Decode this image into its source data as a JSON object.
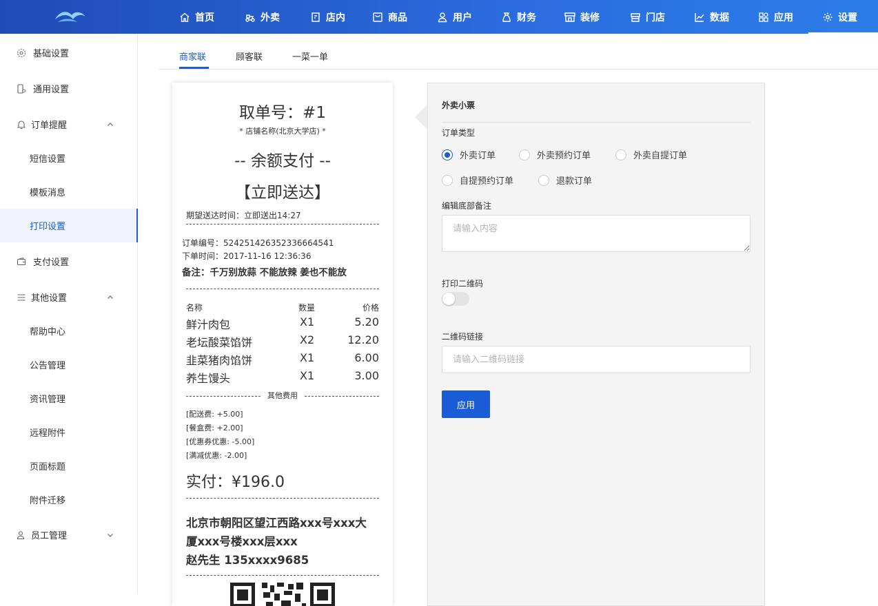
{
  "topnav": {
    "items": [
      {
        "label": "首页",
        "icon": "home-icon"
      },
      {
        "label": "外卖",
        "icon": "delivery-icon"
      },
      {
        "label": "店内",
        "icon": "dine-in-icon"
      },
      {
        "label": "商品",
        "icon": "goods-icon"
      },
      {
        "label": "用户",
        "icon": "user-icon"
      },
      {
        "label": "财务",
        "icon": "finance-icon"
      },
      {
        "label": "装修",
        "icon": "decoration-icon"
      },
      {
        "label": "门店",
        "icon": "store-icon"
      },
      {
        "label": "数据",
        "icon": "data-chart-icon"
      },
      {
        "label": "应用",
        "icon": "apps-icon"
      },
      {
        "label": "设置",
        "icon": "gear-icon"
      }
    ],
    "active": "设置"
  },
  "sidebar": {
    "items": [
      {
        "label": "基础设置",
        "icon": "gear-icon"
      },
      {
        "label": "通用设置",
        "icon": "phone-settings-icon"
      },
      {
        "label": "订单提醒",
        "icon": "bell-icon"
      },
      {
        "label": "短信设置"
      },
      {
        "label": "模板消息"
      },
      {
        "label": "打印设置"
      },
      {
        "label": "支付设置",
        "icon": "wallet-icon"
      },
      {
        "label": "其他设置",
        "icon": "menu-lines-icon"
      },
      {
        "label": "帮助中心"
      },
      {
        "label": "公告管理"
      },
      {
        "label": "资讯管理"
      },
      {
        "label": "远程附件"
      },
      {
        "label": "页面标题"
      },
      {
        "label": "附件迁移"
      },
      {
        "label": "员工管理",
        "icon": "staff-icon"
      }
    ],
    "active": "打印设置"
  },
  "tabs": [
    "商家联",
    "顾客联",
    "一菜一单"
  ],
  "receipt": {
    "pickup_no": "取单号：#1",
    "store_name": "* 店铺名称(北京大学店) *",
    "payment": "-- 余额支付 --",
    "delivery_mode": "【立即送达】",
    "expected_time": "期望送达时间：立即送出14:27",
    "order_no": "订单编号：524251426352336664541",
    "order_time": "下单时间：2017-11-16 12:36:36",
    "remark": "备注：千万别放蒜 不能放辣 姜也不能放",
    "columns": [
      "名称",
      "数量",
      "价格"
    ],
    "items": [
      {
        "name": "鲜汁肉包",
        "qty": "X1",
        "price": "5.20"
      },
      {
        "name": "老坛酸菜馅饼",
        "qty": "X2",
        "price": "12.20"
      },
      {
        "name": "韭菜猪肉馅饼",
        "qty": "X1",
        "price": "6.00"
      },
      {
        "name": "养生馒头",
        "qty": "X1",
        "price": "3.00"
      }
    ],
    "other_fees_title": "其他费用",
    "fees": [
      "[配送费: +5.00]",
      "[餐盒费: +2.00]",
      "[优惠券优惠: -5.00]",
      "[满减优惠: -2.00]"
    ],
    "total": "实付：¥196.0",
    "address_line1": "北京市朝阳区望江西路xxx号xxx大",
    "address_line2": "厦xxx号楼xxx层xxx",
    "contact": "赵先生 135xxxx9685"
  },
  "form": {
    "title": "外卖小票",
    "order_type_label": "订单类型",
    "order_types": [
      "外卖订单",
      "外卖预约订单",
      "外卖自提订单",
      "自提预约订单",
      "退款订单"
    ],
    "selected_order_type": "外卖订单",
    "footer_note_label": "编辑底部备注",
    "footer_note_placeholder": "请输入内容",
    "qr_label": "打印二维码",
    "qr_enabled": false,
    "qr_link_label": "二维码链接",
    "qr_link_placeholder": "请输入二维码链接",
    "apply_label": "应用"
  },
  "colors": {
    "primary": "#1a5bd6",
    "nav_gradient_start": "#1f4bb5",
    "nav_gradient_end": "#2c7de8"
  }
}
